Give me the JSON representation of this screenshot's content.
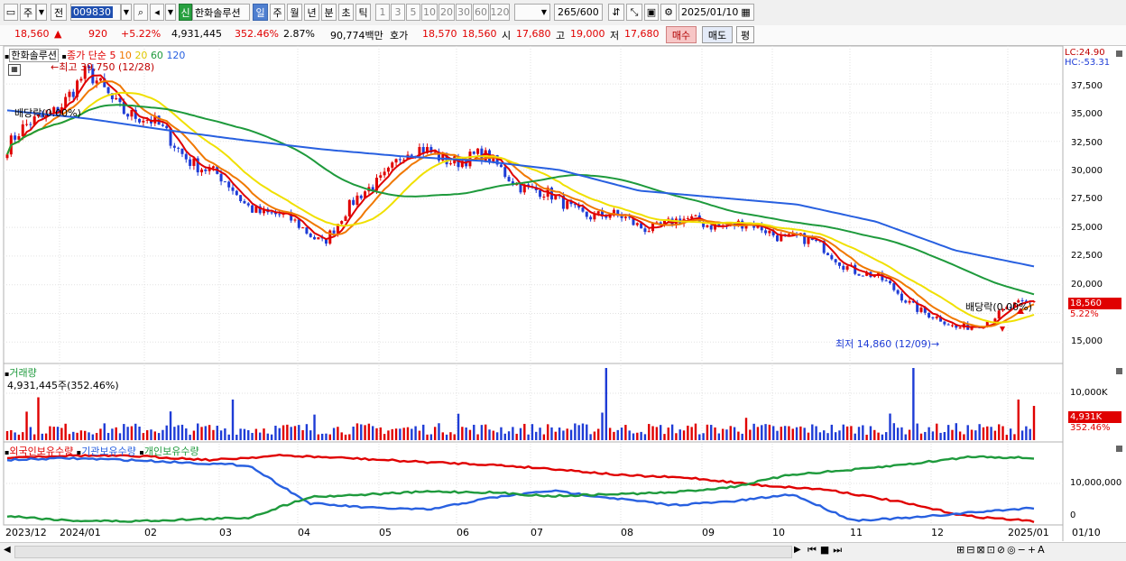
{
  "toolbar": {
    "period_type": "주",
    "prefix_label": "전",
    "stock_code": "009830",
    "badge": "신",
    "stock_name": "한화솔루션",
    "periods": [
      "일",
      "주",
      "월",
      "년",
      "분",
      "초",
      "틱"
    ],
    "selected_period": "일",
    "intervals": [
      "1",
      "3",
      "5",
      "10",
      "20",
      "30",
      "60",
      "120"
    ],
    "range_value": "265",
    "range_total": "/600",
    "date": "2025/01/10"
  },
  "quote": {
    "price": "18,560",
    "change_arrow": "▲",
    "change": "920",
    "change_pct": "+5.22%",
    "volume": "4,931,445",
    "volume_ratio": "352.46%",
    "turnover": "2.87%",
    "amount": "90,774백만",
    "bid_label": "호가",
    "bid_ask": "18,570",
    "bid": "18,560",
    "open_label": "시",
    "open": "17,680",
    "high_label": "고",
    "high": "19,000",
    "low_label": "저",
    "low": "17,680",
    "buy_label": "매수",
    "sell_label": "매도",
    "eval_label": "평"
  },
  "price_panel": {
    "legend_name": "한화솔루션",
    "legend_ma_label": "종가 단순",
    "ma_periods": [
      "5",
      "10",
      "20",
      "60",
      "120"
    ],
    "high_annotation": "최고 39,750 (12/28)",
    "low_annotation": "최저 14,860 (12/09)",
    "dividend_label_left": "배당락(0.00%)",
    "dividend_label_right": "배당락(0.00%)",
    "lc": "LC:24.90",
    "hc": "HC:-53.31",
    "last_price_tag": "18,560",
    "last_pct_tag": "5.22%",
    "y_ticks": [
      "37,500",
      "35,000",
      "32,500",
      "30,000",
      "27,500",
      "25,000",
      "22,500",
      "20,000",
      "15,000"
    ]
  },
  "volume_panel": {
    "title": "거래량",
    "value": "4,931,445주(352.46%)",
    "y_tick": "10,000K",
    "last_tag": "4,931K",
    "last_pct": "352.46%"
  },
  "holdings_panel": {
    "series": [
      "외국인보유수량",
      "기관보유수량",
      "개인보유수량"
    ],
    "y_ticks": [
      "10,000,000",
      "0"
    ]
  },
  "x_axis": [
    "2023/12",
    "2024/01",
    "02",
    "03",
    "04",
    "05",
    "06",
    "07",
    "08",
    "09",
    "10",
    "11",
    "12",
    "2025/01",
    "01/10"
  ],
  "colors": {
    "up": "#e00000",
    "down": "#1e3cd6",
    "ma5": "#e00000",
    "ma10": "#f07800",
    "ma20": "#f0e000",
    "ma60": "#1e9a3c",
    "ma120": "#2860e0",
    "foreign": "#e00000",
    "institution": "#2860e0",
    "individual": "#1e9a3c"
  },
  "chart_data": [
    {
      "type": "line",
      "title": "",
      "series": [
        {
          "name": "종가",
          "dates": [
            "2023/12",
            "2024/01",
            "02",
            "03",
            "04",
            "05",
            "06",
            "07",
            "08",
            "09",
            "10",
            "11",
            "12",
            "2025/01"
          ],
          "values": [
            32000,
            38000,
            33000,
            27300,
            24000,
            31500,
            31000,
            27000,
            25200,
            25500,
            24200,
            20500,
            16000,
            18560
          ]
        },
        {
          "name": "120",
          "dates": [
            "2023/12",
            "2024/01",
            "02",
            "03",
            "04",
            "05",
            "06",
            "07",
            "08",
            "09",
            "10",
            "11",
            "12",
            "2025/01"
          ],
          "values": [
            35200,
            34500,
            33500,
            32600,
            31800,
            31200,
            30800,
            30000,
            28200,
            27600,
            27000,
            25500,
            23000,
            21600
          ]
        }
      ],
      "ylim": [
        14000,
        40500
      ]
    },
    {
      "type": "bar",
      "title": "거래량",
      "ylim": [
        0,
        16000
      ]
    },
    {
      "type": "line",
      "title": "보유수량",
      "series": [
        {
          "name": "외국인보유수량"
        },
        {
          "name": "기관보유수량"
        },
        {
          "name": "개인보유수량"
        }
      ]
    }
  ]
}
